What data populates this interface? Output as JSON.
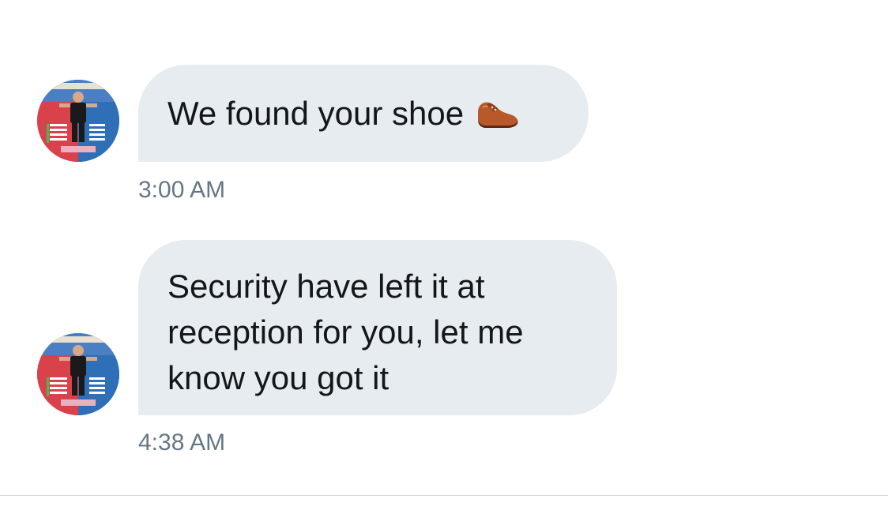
{
  "messages": [
    {
      "text": "We found your shoe",
      "icon": "shoe-emoji-icon",
      "time": "3:00 AM"
    },
    {
      "text": "Security have left it at reception for you, let me know you got it",
      "time": "4:38 AM"
    }
  ],
  "colors": {
    "bubble": "#e6ecf0",
    "text": "#14171a",
    "timestamp": "#657786",
    "divider": "#ccd6dd"
  }
}
